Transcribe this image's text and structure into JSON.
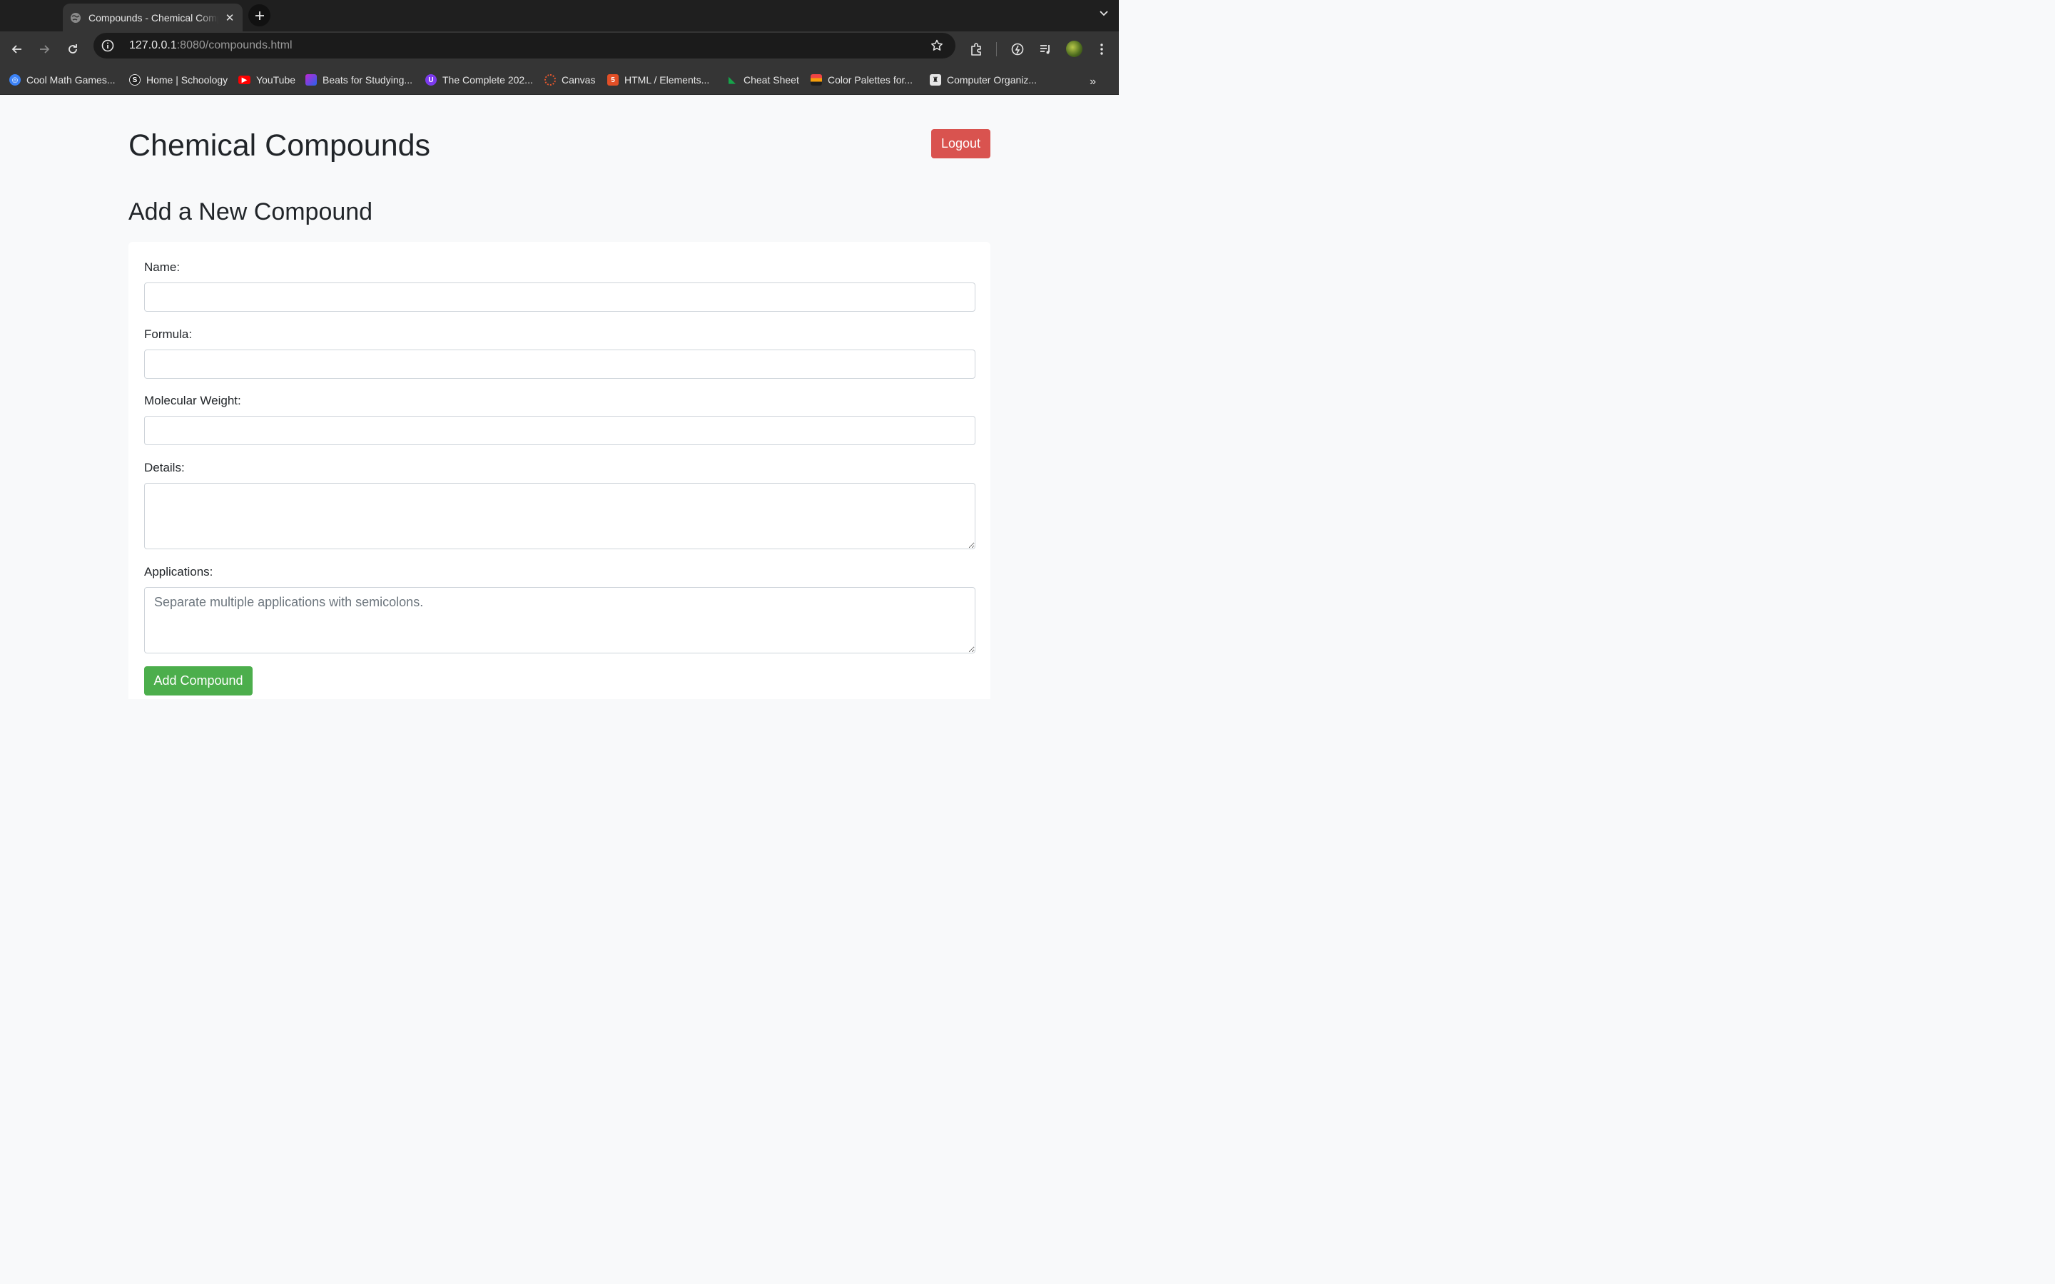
{
  "browser": {
    "tab_title": "Compounds - Chemical Compounds",
    "url_host": "127.0.0.1",
    "url_path": ":8080/compounds.html",
    "bookmarks": [
      {
        "label": "Cool Math Games...",
        "icon": "coolmath-icon",
        "color": "#3b82f6"
      },
      {
        "label": "Home | Schoology",
        "icon": "schoology-icon",
        "color": "#1f1f1f"
      },
      {
        "label": "YouTube",
        "icon": "youtube-icon",
        "color": "#ff0000"
      },
      {
        "label": "Beats for Studying...",
        "icon": "beats-icon",
        "color": "#c026d3"
      },
      {
        "label": "The Complete 202...",
        "icon": "udemy-icon",
        "color": "#7c3aed"
      },
      {
        "label": "Canvas",
        "icon": "canvas-icon",
        "color": "#e4572e"
      },
      {
        "label": "HTML / Elements...",
        "icon": "html-icon",
        "color": "#e34f26"
      },
      {
        "label": "Cheat Sheet",
        "icon": "cheatsheet-icon",
        "color": "#16a34a"
      },
      {
        "label": "Color Palettes for...",
        "icon": "palette-icon",
        "color": "#f59e0b"
      },
      {
        "label": "Computer Organiz...",
        "icon": "computer-org-icon",
        "color": "#e5e5e5"
      }
    ]
  },
  "header": {
    "title": "Chemical Compounds",
    "logout_label": "Logout"
  },
  "form": {
    "section_title": "Add a New Compound",
    "name_label": "Name:",
    "name_value": "",
    "formula_label": "Formula:",
    "formula_value": "",
    "molecular_weight_label": "Molecular Weight:",
    "molecular_weight_value": "",
    "details_label": "Details:",
    "details_value": "",
    "applications_label": "Applications:",
    "applications_placeholder": "Separate multiple applications with semicolons.",
    "submit_label": "Add Compound"
  },
  "colors": {
    "logout": "#d9534f",
    "submit": "#4cae4c",
    "page_bg": "#f8f9fa"
  }
}
